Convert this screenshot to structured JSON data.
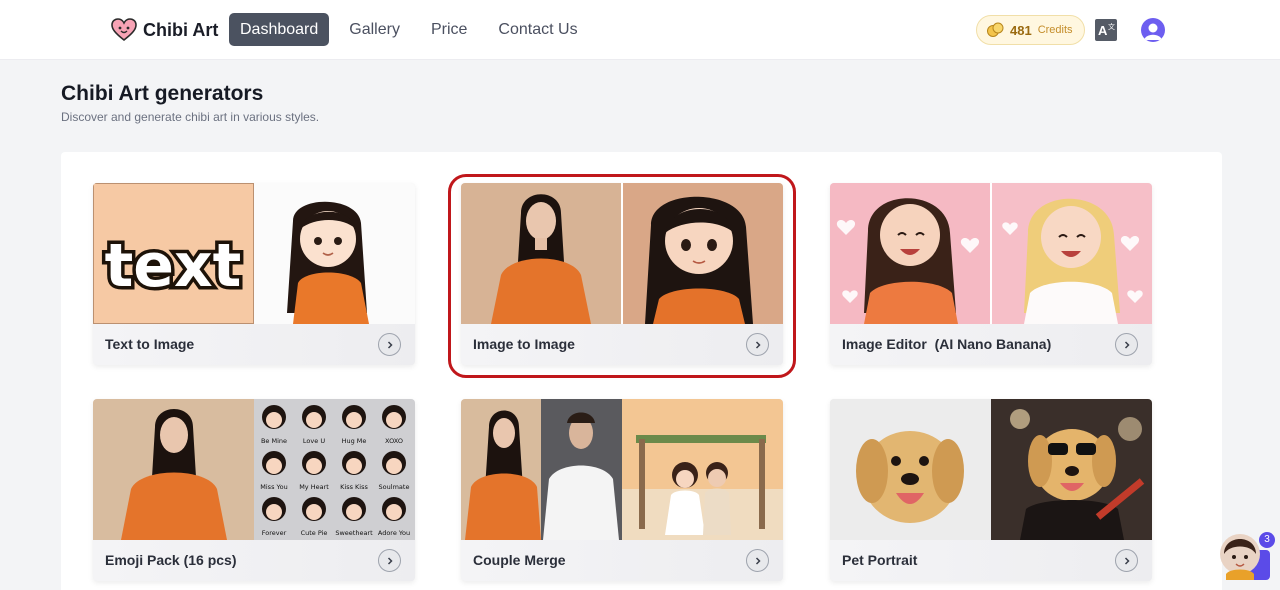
{
  "header": {
    "brand": "Chibi Art",
    "nav": [
      {
        "label": "Dashboard",
        "active": true
      },
      {
        "label": "Gallery",
        "active": false
      },
      {
        "label": "Price",
        "active": false
      },
      {
        "label": "Contact Us",
        "active": false
      }
    ],
    "credits": {
      "value": "481",
      "label": "Credits",
      "icon": "coin-icon"
    },
    "translate_icon": "translate-icon",
    "avatar_icon": "user-avatar-icon"
  },
  "page": {
    "title": "Chibi Art generators",
    "subtitle": "Discover and generate chibi art in various styles."
  },
  "cards": [
    {
      "label": "Text to Image",
      "icon": "chevron-right-icon"
    },
    {
      "label": "Image to Image",
      "icon": "chevron-right-icon",
      "highlighted": true
    },
    {
      "label": "Image Editor  (AI Nano Banana)",
      "icon": "chevron-right-icon"
    },
    {
      "label": "Emoji Pack (16 pcs)",
      "icon": "chevron-right-icon"
    },
    {
      "label": "Couple Merge",
      "icon": "chevron-right-icon"
    },
    {
      "label": "Pet Portrait",
      "icon": "chevron-right-icon"
    }
  ],
  "card1_image_text": "text",
  "emoji_labels": [
    "Be Mine",
    "Love U",
    "Hug Me",
    "XOXO",
    "Miss You",
    "My Heart",
    "Kiss Kiss",
    "Soulmate",
    "Forever",
    "Cute Pie",
    "Sweetheart",
    "Adore You"
  ],
  "floating_widget": {
    "badge": "3"
  },
  "colors": {
    "accent": "#4b5260",
    "highlight": "#c0171b",
    "credits_bg": "#fff7e0",
    "avatar": "#6d5ef0"
  }
}
